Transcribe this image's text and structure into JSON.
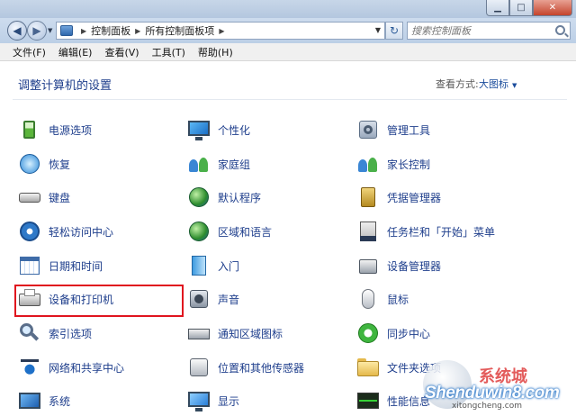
{
  "window": {
    "minimize": "▁",
    "maximize": "□",
    "close": "✕"
  },
  "nav": {
    "back_glyph": "◀",
    "forward_glyph": "▶",
    "breadcrumb": [
      "控制面板",
      "所有控制面板项"
    ],
    "search_placeholder": "搜索控制面板",
    "refresh_glyph": "↻"
  },
  "menu": [
    "文件(F)",
    "编辑(E)",
    "查看(V)",
    "工具(T)",
    "帮助(H)"
  ],
  "header": {
    "title": "调整计算机的设置",
    "view_by_label": "查看方式:",
    "view_by_value": "大图标"
  },
  "items": {
    "c1": [
      {
        "label": "电源选项",
        "icon": "power-icon"
      },
      {
        "label": "恢复",
        "icon": "recovery-icon"
      },
      {
        "label": "键盘",
        "icon": "keyboard-icon"
      },
      {
        "label": "轻松访问中心",
        "icon": "ease-of-access-icon"
      },
      {
        "label": "日期和时间",
        "icon": "calendar-icon"
      },
      {
        "label": "设备和打印机",
        "icon": "printer-icon"
      },
      {
        "label": "索引选项",
        "icon": "magnifier-icon"
      },
      {
        "label": "网络和共享中心",
        "icon": "network-icon"
      },
      {
        "label": "系统",
        "icon": "system-icon"
      }
    ],
    "c2": [
      {
        "label": "个性化",
        "icon": "personalization-icon"
      },
      {
        "label": "家庭组",
        "icon": "homegroup-icon"
      },
      {
        "label": "默认程序",
        "icon": "default-programs-icon"
      },
      {
        "label": "区域和语言",
        "icon": "globe-icon"
      },
      {
        "label": "入门",
        "icon": "getting-started-icon"
      },
      {
        "label": "声音",
        "icon": "speaker-icon"
      },
      {
        "label": "通知区域图标",
        "icon": "notification-tray-icon"
      },
      {
        "label": "位置和其他传感器",
        "icon": "sensor-icon"
      },
      {
        "label": "显示",
        "icon": "display-icon"
      }
    ],
    "c3": [
      {
        "label": "管理工具",
        "icon": "admin-tools-icon"
      },
      {
        "label": "家长控制",
        "icon": "parental-controls-icon"
      },
      {
        "label": "凭据管理器",
        "icon": "credential-vault-icon"
      },
      {
        "label": "任务栏和「开始」菜单",
        "icon": "taskbar-icon"
      },
      {
        "label": "设备管理器",
        "icon": "device-manager-icon"
      },
      {
        "label": "鼠标",
        "icon": "mouse-icon"
      },
      {
        "label": "同步中心",
        "icon": "sync-icon"
      },
      {
        "label": "文件夹选项",
        "icon": "folder-icon"
      },
      {
        "label": "性能信息",
        "icon": "performance-icon"
      }
    ]
  },
  "watermark": {
    "text": "Shenduwin8.com",
    "site": "xitongcheng.com",
    "cn": "系统城"
  },
  "colors": {
    "link": "#1e3e8c",
    "highlight": "#e0141e"
  }
}
